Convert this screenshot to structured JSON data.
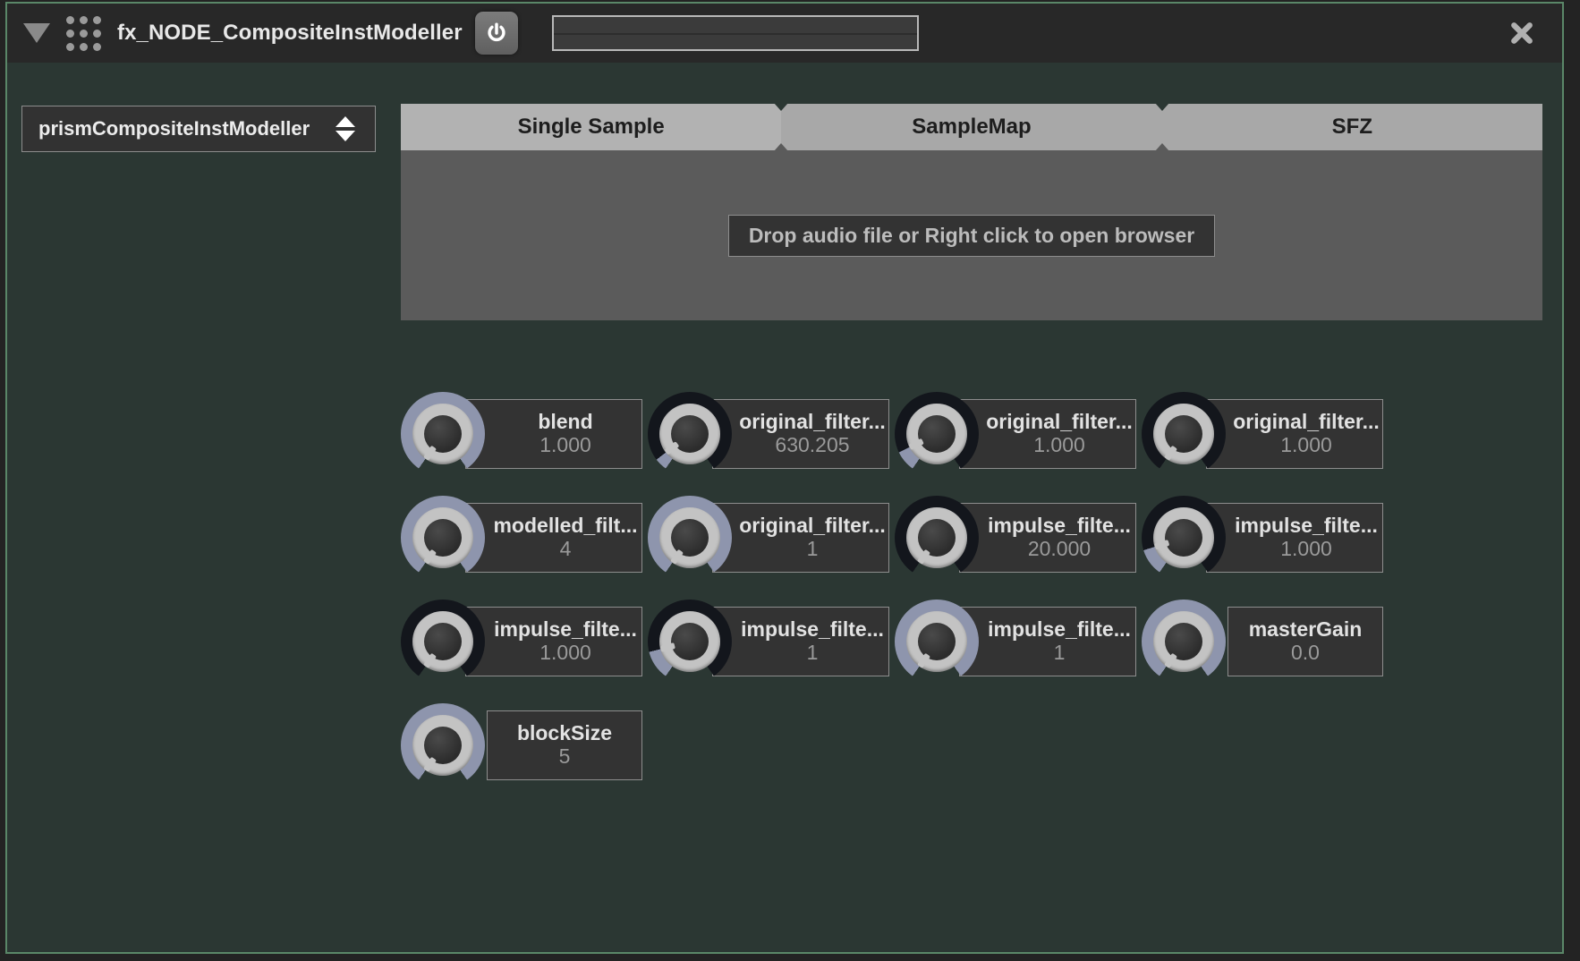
{
  "window": {
    "accent_border": "#5a8768",
    "background": "#2b3733",
    "header_background": "#282828"
  },
  "header": {
    "collapse_icon": "collapse-triangle-icon",
    "drag_icon": "drag-dots-icon",
    "title": "fx_NODE_CompositeInstModeller",
    "power_icon": "power-icon",
    "meter_value": "",
    "close_icon": "close-icon"
  },
  "preset": {
    "selected": "prismCompositeInstModeller",
    "arrows_icon": "updown-arrows-icon"
  },
  "sampler": {
    "tabs": [
      {
        "label": "Single Sample",
        "active": true
      },
      {
        "label": "SampleMap",
        "active": false
      },
      {
        "label": "SFZ",
        "active": false
      }
    ],
    "drop_hint": "Drop audio file or Right click to open browser"
  },
  "knobs": [
    {
      "name": "blend",
      "value": "1.000",
      "arc": 0.0,
      "style": "light"
    },
    {
      "name": "original_filter...",
      "value": "630.205",
      "arc": 0.06,
      "style": "dark"
    },
    {
      "name": "original_filter...",
      "value": "1.000",
      "arc": 0.1,
      "style": "dark"
    },
    {
      "name": "original_filter...",
      "value": "1.000",
      "arc": 0.0,
      "style": "dark"
    },
    {
      "name": "modelled_filt...",
      "value": "4",
      "arc": 0.0,
      "style": "light"
    },
    {
      "name": "original_filter...",
      "value": "1",
      "arc": 0.0,
      "style": "light"
    },
    {
      "name": "impulse_filte...",
      "value": "20.000",
      "arc": 0.0,
      "style": "dark"
    },
    {
      "name": "impulse_filte...",
      "value": "1.000",
      "arc": 0.13,
      "style": "dark"
    },
    {
      "name": "impulse_filte...",
      "value": "1.000",
      "arc": 0.0,
      "style": "dark"
    },
    {
      "name": "impulse_filte...",
      "value": "1",
      "arc": 0.14,
      "style": "dark"
    },
    {
      "name": "impulse_filte...",
      "value": "1",
      "arc": 0.0,
      "style": "light"
    },
    {
      "name": "masterGain",
      "value": "0.0",
      "arc": 0.0,
      "style": "light",
      "centered": true
    },
    {
      "name": "blockSize",
      "value": "5",
      "arc": 0.0,
      "style": "light",
      "centered": true
    }
  ]
}
